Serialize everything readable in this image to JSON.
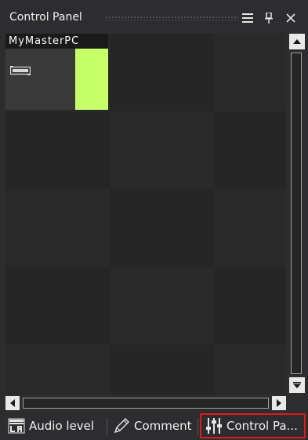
{
  "panel": {
    "title": "Control Panel"
  },
  "titlebar_buttons": [
    "menu-icon",
    "pin-icon",
    "close-icon"
  ],
  "device": {
    "name": "MyMasterPC",
    "level_fill": 1.0,
    "meter_color": "#c6ff6a"
  },
  "tabs": [
    {
      "label": "Audio level",
      "icon": "audio-level-icon",
      "active": false
    },
    {
      "label": "Comment",
      "icon": "pencil-icon",
      "active": false
    },
    {
      "label": "Control Pa...",
      "icon": "sliders-icon",
      "active": true
    }
  ],
  "colors": {
    "background": "#2d2d30",
    "active_tab_border": "#e01a1a"
  }
}
